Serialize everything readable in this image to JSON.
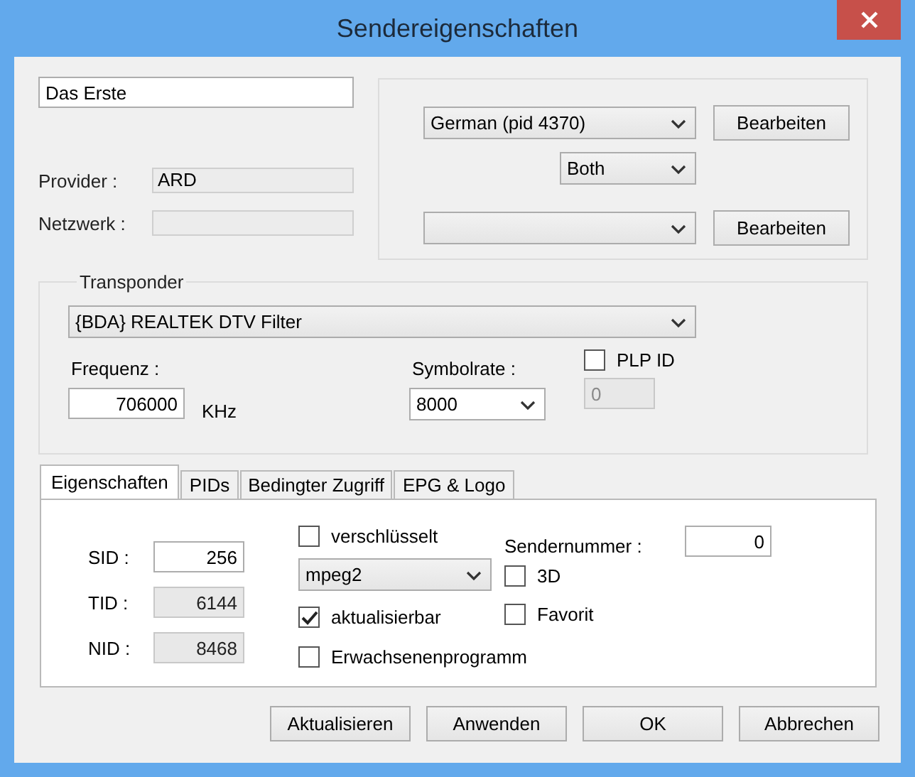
{
  "window": {
    "title": "Sendereigenschaften"
  },
  "channel_name": "Das Erste",
  "provider": {
    "label": "Provider :",
    "value": "ARD"
  },
  "network": {
    "label": "Netzwerk :"
  },
  "audio": {
    "select": "German (pid 4370)",
    "button": "Bearbeiten",
    "mode": "Both"
  },
  "second": {
    "button": "Bearbeiten"
  },
  "transponder": {
    "title": "Transponder",
    "device": "{BDA} REALTEK DTV Filter",
    "frequency": {
      "label": "Frequenz :",
      "value": "706000",
      "unit": "KHz"
    },
    "symbolrate": {
      "label": "Symbolrate :",
      "value": "8000"
    },
    "plp": {
      "label": "PLP ID",
      "checked": false,
      "value": "0",
      "disabled": true
    }
  },
  "tabs": [
    {
      "label": "Eigenschaften",
      "selected": true
    },
    {
      "label": "PIDs",
      "selected": false
    },
    {
      "label": "Bedingter Zugriff",
      "selected": false
    },
    {
      "label": "EPG & Logo",
      "selected": false
    }
  ],
  "ids": [
    {
      "label": "SID :",
      "value": "256",
      "disabled": false
    },
    {
      "label": "TID :",
      "value": "6144",
      "disabled": true
    },
    {
      "label": "NID :",
      "value": "8468",
      "disabled": true
    }
  ],
  "options": [
    {
      "kind": "checkbox",
      "label": "verschlüsselt",
      "checked": false
    },
    {
      "kind": "select",
      "value": "mpeg2"
    },
    {
      "kind": "checkbox",
      "label": "aktualisierbar",
      "checked": true
    },
    {
      "kind": "checkbox",
      "label": "Erwachsenenprogramm",
      "checked": false
    }
  ],
  "channel_number": {
    "label": "Sendernummer :",
    "value": "0"
  },
  "flags": [
    {
      "label": "3D",
      "checked": false
    },
    {
      "label": "Favorit",
      "checked": false
    }
  ],
  "buttons": [
    "Aktualisieren",
    "Anwenden",
    "OK",
    "Abbrechen"
  ]
}
